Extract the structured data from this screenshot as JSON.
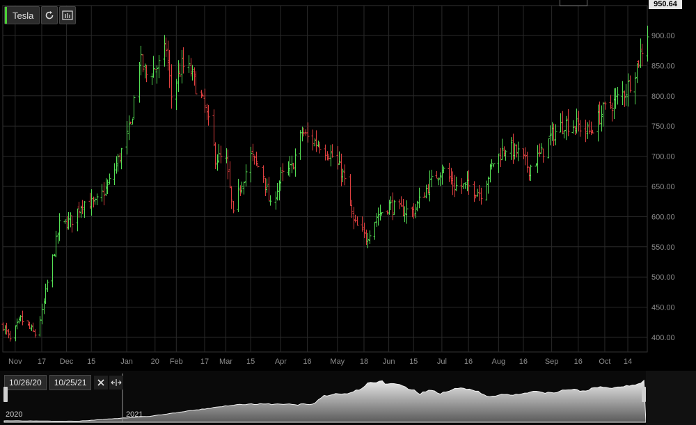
{
  "symbol": {
    "name": "Tesla",
    "accent_color": "#4cd137"
  },
  "toolbar": {
    "refresh_icon": "refresh-icon",
    "chart_type_icon": "bar-chart-icon"
  },
  "last_price": "950.64",
  "navigator": {
    "start_date": "10/26/20",
    "end_date": "10/25/21",
    "clear_icon": "close-icon",
    "fit_icon": "fit-width-icon",
    "year_labels": [
      "2020",
      "2021"
    ]
  },
  "colors": {
    "up": "#55e055",
    "down": "#e04040",
    "grid": "#2a2a2a",
    "axis_text": "#8c8c8c"
  },
  "chart_data": {
    "type": "ohlc",
    "title": "Tesla",
    "ylim": [
      380,
      950
    ],
    "yticks": [
      400,
      450,
      500,
      550,
      600,
      650,
      700,
      750,
      800,
      850,
      900
    ],
    "x_tick_labels": [
      "Nov",
      "17",
      "Dec",
      "15",
      "Jan",
      "20",
      "Feb",
      "17",
      "Mar",
      "15",
      "Apr",
      "16",
      "May",
      "18",
      "Jun",
      "15",
      "Jul",
      "16",
      "Aug",
      "16",
      "Sep",
      "16",
      "Oct",
      "14"
    ],
    "x_tick_dates": [
      "2020-11-02",
      "2020-11-17",
      "2020-12-01",
      "2020-12-15",
      "2021-01-04",
      "2021-01-20",
      "2021-02-01",
      "2021-02-17",
      "2021-03-01",
      "2021-03-15",
      "2021-04-01",
      "2021-04-16",
      "2021-05-03",
      "2021-05-18",
      "2021-06-01",
      "2021-06-15",
      "2021-07-01",
      "2021-07-16",
      "2021-08-02",
      "2021-08-16",
      "2021-09-01",
      "2021-09-16",
      "2021-10-01",
      "2021-10-14"
    ],
    "x_range": [
      "2020-10-26",
      "2021-10-25"
    ],
    "closes": [
      [
        "2020-10-26",
        420
      ],
      [
        "2020-10-30",
        395
      ],
      [
        "2020-11-05",
        430
      ],
      [
        "2020-11-10",
        415
      ],
      [
        "2020-11-13",
        405
      ],
      [
        "2020-11-17",
        440
      ],
      [
        "2020-11-20",
        490
      ],
      [
        "2020-11-27",
        585
      ],
      [
        "2020-12-04",
        595
      ],
      [
        "2020-12-10",
        625
      ],
      [
        "2020-12-17",
        620
      ],
      [
        "2020-12-24",
        650
      ],
      [
        "2020-12-31",
        700
      ],
      [
        "2021-01-06",
        750
      ],
      [
        "2021-01-11",
        860
      ],
      [
        "2021-01-15",
        835
      ],
      [
        "2021-01-22",
        850
      ],
      [
        "2021-01-26",
        880
      ],
      [
        "2021-01-29",
        800
      ],
      [
        "2021-02-04",
        850
      ],
      [
        "2021-02-09",
        840
      ],
      [
        "2021-02-17",
        780
      ],
      [
        "2021-02-23",
        700
      ],
      [
        "2021-03-01",
        690
      ],
      [
        "2021-03-05",
        600
      ],
      [
        "2021-03-09",
        650
      ],
      [
        "2021-03-15",
        700
      ],
      [
        "2021-03-22",
        670
      ],
      [
        "2021-03-26",
        615
      ],
      [
        "2021-04-01",
        665
      ],
      [
        "2021-04-07",
        680
      ],
      [
        "2021-04-13",
        740
      ],
      [
        "2021-04-16",
        730
      ],
      [
        "2021-04-23",
        720
      ],
      [
        "2021-04-30",
        700
      ],
      [
        "2021-05-06",
        670
      ],
      [
        "2021-05-12",
        590
      ],
      [
        "2021-05-19",
        565
      ],
      [
        "2021-05-25",
        600
      ],
      [
        "2021-06-01",
        620
      ],
      [
        "2021-06-07",
        610
      ],
      [
        "2021-06-15",
        610
      ],
      [
        "2021-06-23",
        650
      ],
      [
        "2021-07-01",
        680
      ],
      [
        "2021-07-08",
        650
      ],
      [
        "2021-07-16",
        650
      ],
      [
        "2021-07-23",
        640
      ],
      [
        "2021-07-30",
        690
      ],
      [
        "2021-08-06",
        715
      ],
      [
        "2021-08-13",
        705
      ],
      [
        "2021-08-19",
        680
      ],
      [
        "2021-08-26",
        705
      ],
      [
        "2021-09-01",
        735
      ],
      [
        "2021-09-08",
        755
      ],
      [
        "2021-09-16",
        750
      ],
      [
        "2021-09-22",
        740
      ],
      [
        "2021-09-30",
        775
      ],
      [
        "2021-10-06",
        790
      ],
      [
        "2021-10-13",
        810
      ],
      [
        "2021-10-19",
        850
      ],
      [
        "2021-10-21",
        870
      ],
      [
        "2021-10-25",
        905
      ]
    ]
  }
}
